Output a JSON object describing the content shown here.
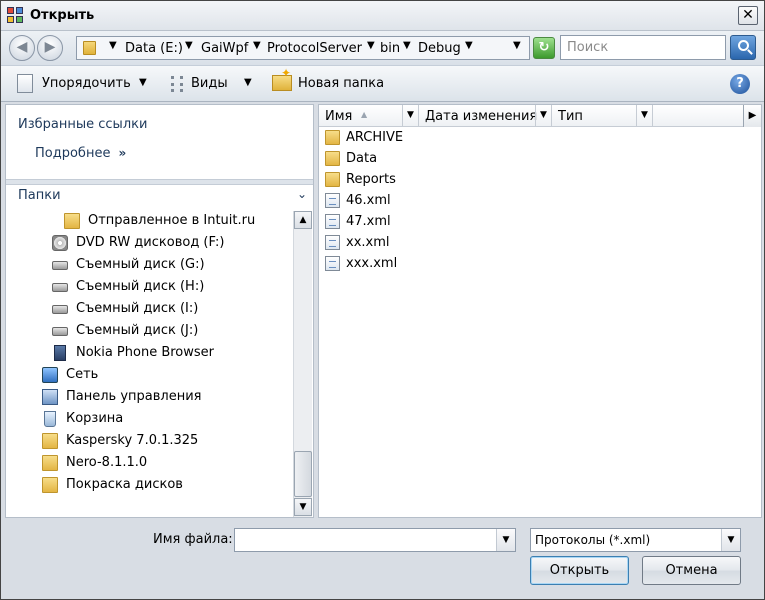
{
  "window": {
    "title": "Открыть",
    "close_glyph": "✕"
  },
  "address": {
    "back_glyph": "◀",
    "forward_glyph": "▶",
    "segments": [
      "Data (E:)",
      "GaiWpf",
      "ProtocolServer",
      "bin",
      "Debug"
    ],
    "search_placeholder": "Поиск"
  },
  "toolbar": {
    "organize_label": "Упорядочить",
    "views_label": "Виды",
    "new_folder_label": "Новая папка",
    "help_glyph": "?"
  },
  "left_pane": {
    "favorites_title": "Избранные ссылки",
    "details_label": "Подробнее",
    "details_glyph": "»",
    "folders_title": "Папки",
    "folders_chevron": "⌄",
    "tree": [
      {
        "label": "Отправленное в Intuit.ru",
        "icon": "folder-icon"
      },
      {
        "label": "DVD RW дисковод (F:)",
        "icon": "dvd-drive-icon"
      },
      {
        "label": "Съемный диск (G:)",
        "icon": "removable-drive-icon"
      },
      {
        "label": "Съемный диск (H:)",
        "icon": "removable-drive-icon"
      },
      {
        "label": "Съемный диск (I:)",
        "icon": "removable-drive-icon"
      },
      {
        "label": "Съемный диск (J:)",
        "icon": "removable-drive-icon"
      },
      {
        "label": "Nokia Phone Browser",
        "icon": "phone-icon"
      },
      {
        "label": "Сеть",
        "icon": "network-icon"
      },
      {
        "label": "Панель управления",
        "icon": "control-panel-icon"
      },
      {
        "label": "Корзина",
        "icon": "recycle-bin-icon"
      },
      {
        "label": "Kaspersky 7.0.1.325",
        "icon": "folder-icon"
      },
      {
        "label": "Nero-8.1.1.0",
        "icon": "folder-icon"
      },
      {
        "label": "Покраска дисков",
        "icon": "folder-icon"
      }
    ]
  },
  "file_list": {
    "columns": [
      "Имя",
      "Дата изменения",
      "Тип"
    ],
    "items": [
      {
        "name": "ARCHIVE",
        "icon": "folder-icon"
      },
      {
        "name": "Data",
        "icon": "folder-icon"
      },
      {
        "name": "Reports",
        "icon": "folder-icon"
      },
      {
        "name": "46.xml",
        "icon": "xml-file-icon"
      },
      {
        "name": "47.xml",
        "icon": "xml-file-icon"
      },
      {
        "name": "xx.xml",
        "icon": "xml-file-icon"
      },
      {
        "name": "xxx.xml",
        "icon": "xml-file-icon"
      }
    ]
  },
  "bottom": {
    "filename_label": "Имя файла:",
    "filename_value": "",
    "filter_value": "Протоколы (*.xml)",
    "open_label": "Открыть",
    "cancel_label": "Отмена"
  }
}
